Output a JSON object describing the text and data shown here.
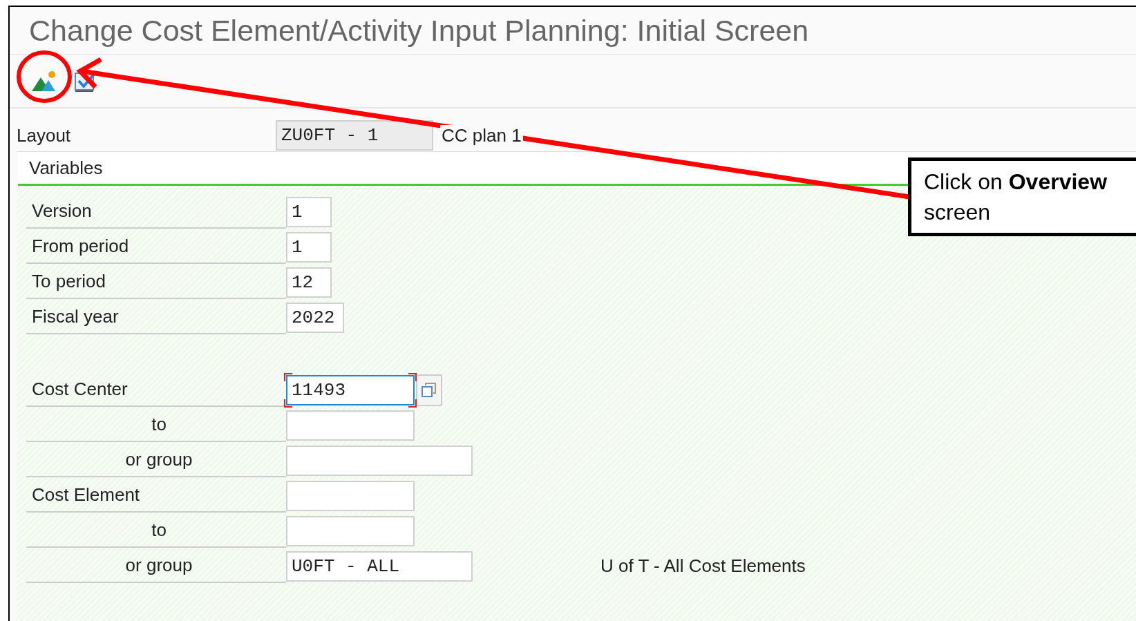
{
  "window": {
    "title": "Change Cost Element/Activity Input Planning: Initial Screen"
  },
  "toolbar": [
    {
      "kind": "overview"
    },
    {
      "kind": "check"
    }
  ],
  "layout": {
    "label": "Layout",
    "value": "ZU0FT - 1",
    "description": "CC plan 1"
  },
  "section": {
    "title": "Variables"
  },
  "groups": [
    [
      {
        "label": "Version",
        "value": "1",
        "kind": "short",
        "sub": false
      },
      {
        "label": "From period",
        "value": "1",
        "kind": "short",
        "sub": false
      },
      {
        "label": "To period",
        "value": "12",
        "kind": "short",
        "sub": false
      },
      {
        "label": "Fiscal year",
        "value": "2022",
        "kind": "year",
        "sub": false
      }
    ],
    [
      {
        "label": "Cost Center",
        "value": "11493",
        "kind": "key",
        "sub": false,
        "focused": true,
        "value_help": true
      },
      {
        "label": "to",
        "kind": "key",
        "sub": true
      },
      {
        "label": "or group",
        "kind": "group",
        "sub": true
      },
      {
        "label": "Cost Element",
        "kind": "key",
        "sub": false
      },
      {
        "label": "to",
        "kind": "key",
        "sub": true
      },
      {
        "label": "or group",
        "value": "U0FT - ALL",
        "kind": "group",
        "sub": true,
        "description": "U of T - All Cost Elements"
      }
    ]
  ],
  "callout": {
    "text": "Click on **Overview**",
    "text2": "screen"
  }
}
